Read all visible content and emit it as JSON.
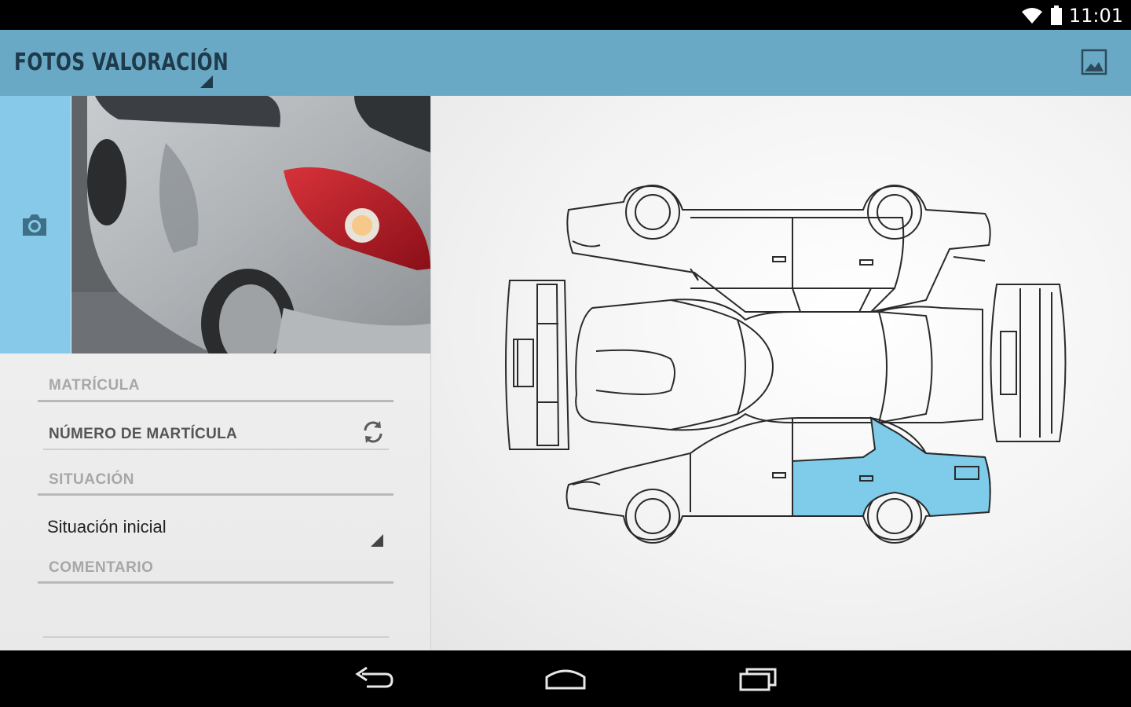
{
  "statusbar": {
    "time": "11:01"
  },
  "appbar": {
    "title": "FOTOS VALORACIÓN"
  },
  "form": {
    "matricula_label": "MATRÍCULA",
    "matricula_placeholder": "NÚMERO DE MARTÍCULA",
    "situacion_label": "SITUACIÓN",
    "situacion_value": "Situación inicial",
    "comentario_label": "COMENTARIO",
    "comentario_value": ""
  },
  "diagram": {
    "highlight_color": "#7ecbea",
    "selected_zone": "rear-right-side"
  },
  "colors": {
    "appbar": "#6aa9c5",
    "camera_strip": "#86c9e8"
  },
  "icons": [
    "wifi-icon",
    "battery-icon",
    "gallery-icon",
    "camera-icon",
    "refresh-icon",
    "back-icon",
    "home-icon",
    "recents-icon"
  ]
}
